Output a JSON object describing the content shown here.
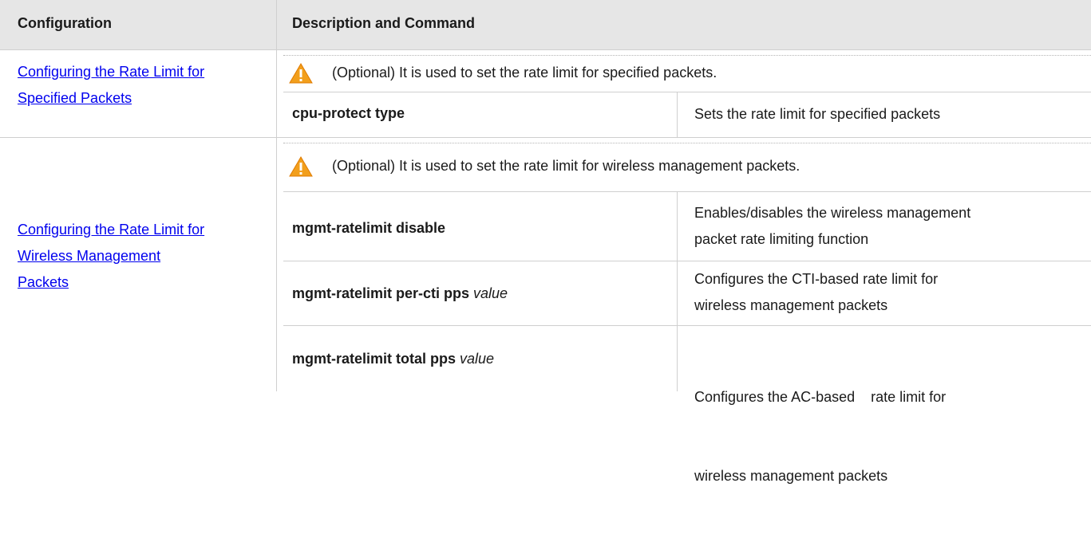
{
  "header": {
    "col1": "Configuration",
    "col2": "Description and Command"
  },
  "section1": {
    "link_line1": "Configuring the Rate Limit for",
    "link_line2": "Specified Packets",
    "note": "(Optional) It is used to set the rate limit for specified packets.",
    "commands": [
      {
        "cmd": "cpu-protect type",
        "arg": "",
        "desc_line1": "Sets the rate limit for specified packets",
        "desc_line2": ""
      }
    ]
  },
  "section2": {
    "link_line1": "Configuring the Rate Limit for",
    "link_line2": "Wireless Management ",
    "link_line3": "Packets",
    "note": "(Optional) It is used to set the rate limit for wireless management packets.",
    "commands": [
      {
        "cmd": "mgmt-ratelimit disable",
        "arg": "",
        "desc_line1": "Enables/disables the wireless management",
        "desc_line2": "packet rate limiting function"
      },
      {
        "cmd": "mgmt-ratelimit per-cti pps ",
        "arg": "value",
        "desc_line1": "Configures the CTI-based rate limit for",
        "desc_line2": "wireless management packets"
      },
      {
        "cmd": "mgmt-ratelimit total pps ",
        "arg": "value",
        "desc_line1": "Configures the AC-based    rate limit for",
        "desc_line2": "wireless management packets"
      }
    ]
  },
  "colors": {
    "header_bg": "#e6e6e6",
    "link": "#0000ee",
    "warning": "#f29f1c"
  },
  "icons": {
    "note": "warning-icon"
  }
}
